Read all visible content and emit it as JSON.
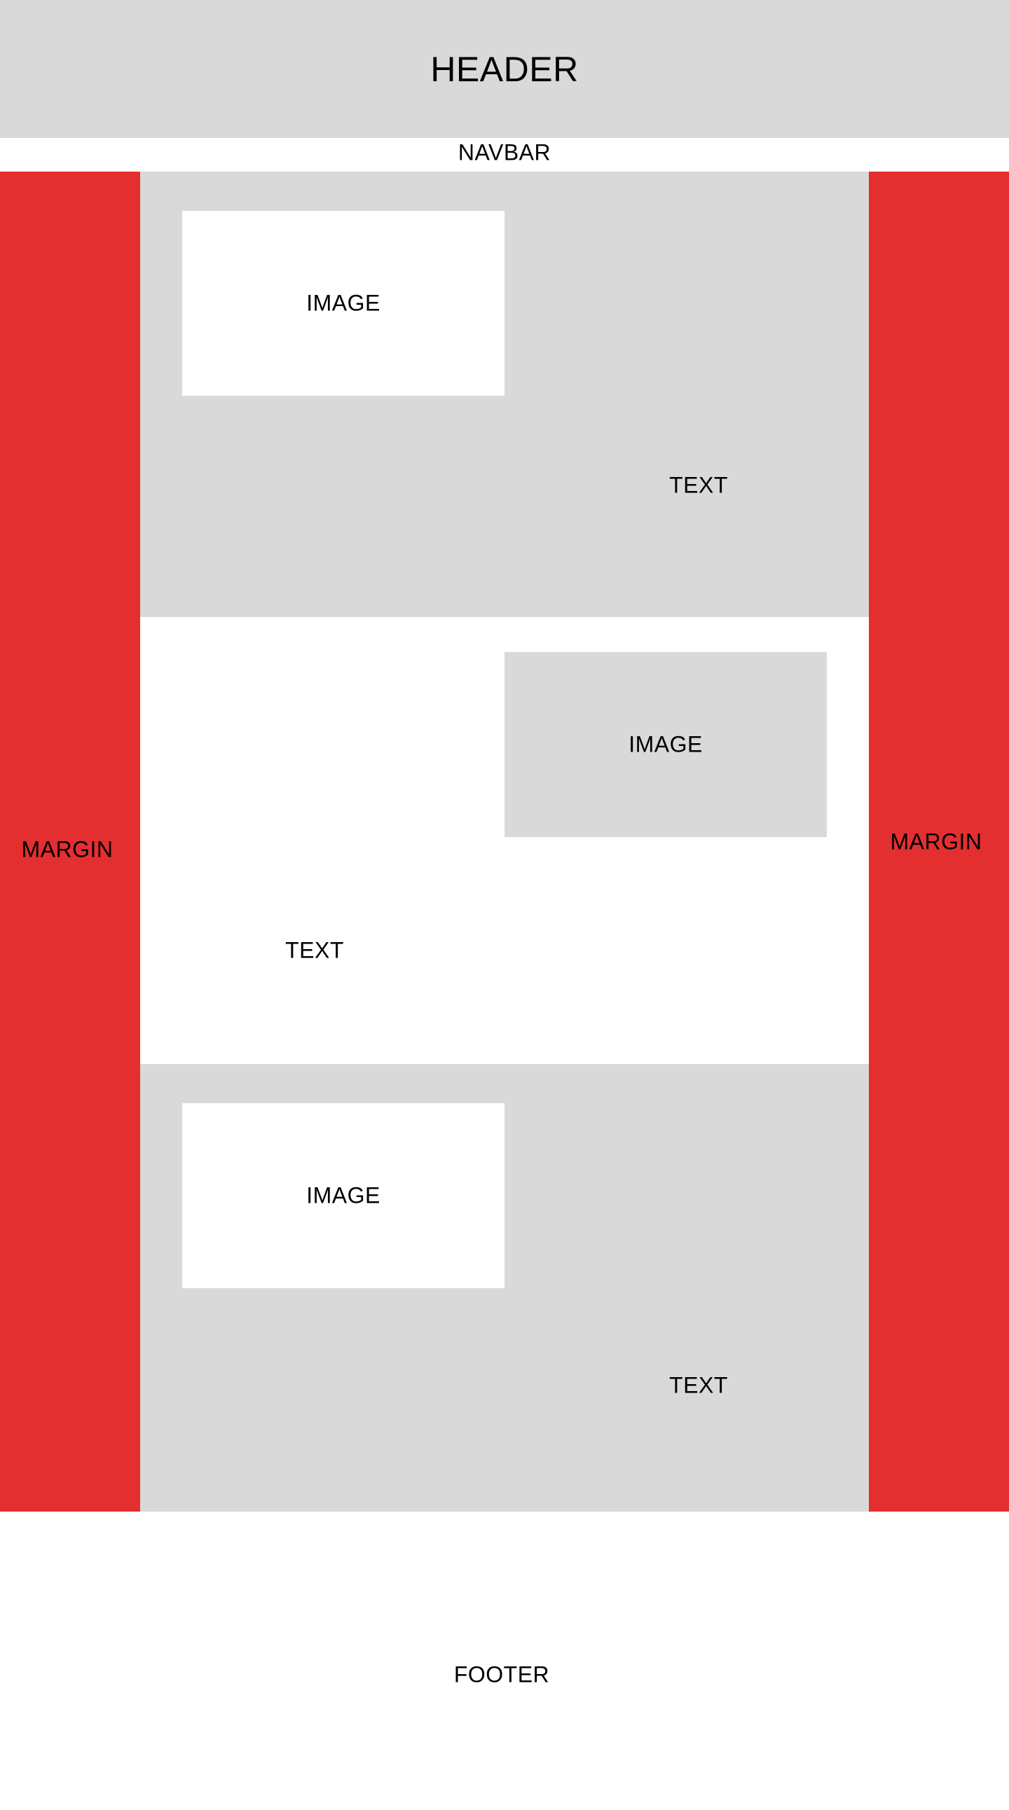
{
  "header": {
    "label": "HEADER"
  },
  "navbar": {
    "label": "NAVBAR"
  },
  "margins": {
    "left_label": "MARGIN",
    "right_label": "MARGIN"
  },
  "sections": [
    {
      "image_label": "IMAGE",
      "text_label": "TEXT"
    },
    {
      "image_label": "IMAGE",
      "text_label": "TEXT"
    },
    {
      "image_label": "IMAGE",
      "text_label": "TEXT"
    }
  ],
  "footer": {
    "label": "FOOTER"
  },
  "colors": {
    "gray": "#d9d9d9",
    "margin_red": "#e32f30",
    "white": "#ffffff",
    "text": "#000000"
  }
}
